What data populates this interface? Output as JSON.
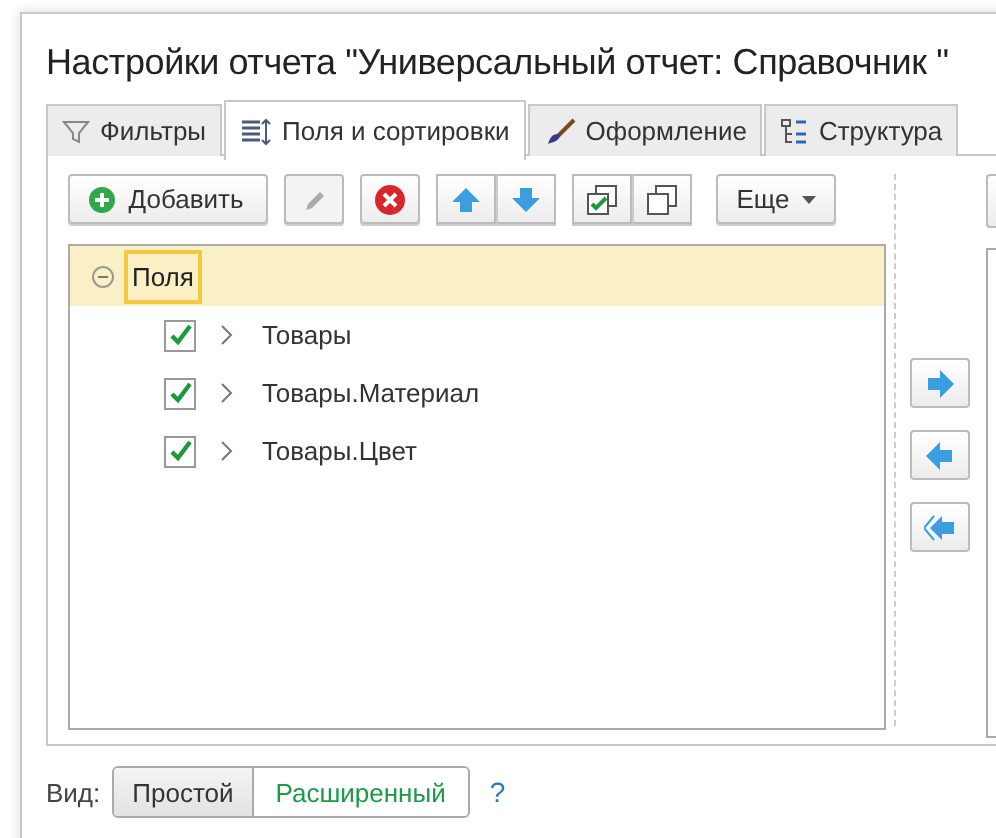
{
  "window": {
    "title": "Настройки отчета \"Универсальный отчет: Справочник \""
  },
  "tabs": [
    {
      "label": "Фильтры",
      "kind": "filter",
      "selected": false
    },
    {
      "label": "Поля и сортировки",
      "kind": "sort",
      "selected": true
    },
    {
      "label": "Оформление",
      "kind": "brush",
      "selected": false
    },
    {
      "label": "Структура",
      "kind": "structure",
      "selected": false
    }
  ],
  "toolbar": {
    "add": "Добавить",
    "edit_disabled": true,
    "more": "Еще"
  },
  "tree": {
    "label": "Поля",
    "expanded": true,
    "selected": true,
    "children": [
      {
        "label": "Товары",
        "checked": true,
        "expanded": false
      },
      {
        "label": "Товары.Материал",
        "checked": true,
        "expanded": false
      },
      {
        "label": "Товары.Цвет",
        "checked": true,
        "expanded": false
      }
    ]
  },
  "view": {
    "label": "Вид:",
    "options": [
      {
        "label": "Простой",
        "selected": false
      },
      {
        "label": "Расширенный",
        "selected": true
      }
    ],
    "help": "?"
  }
}
